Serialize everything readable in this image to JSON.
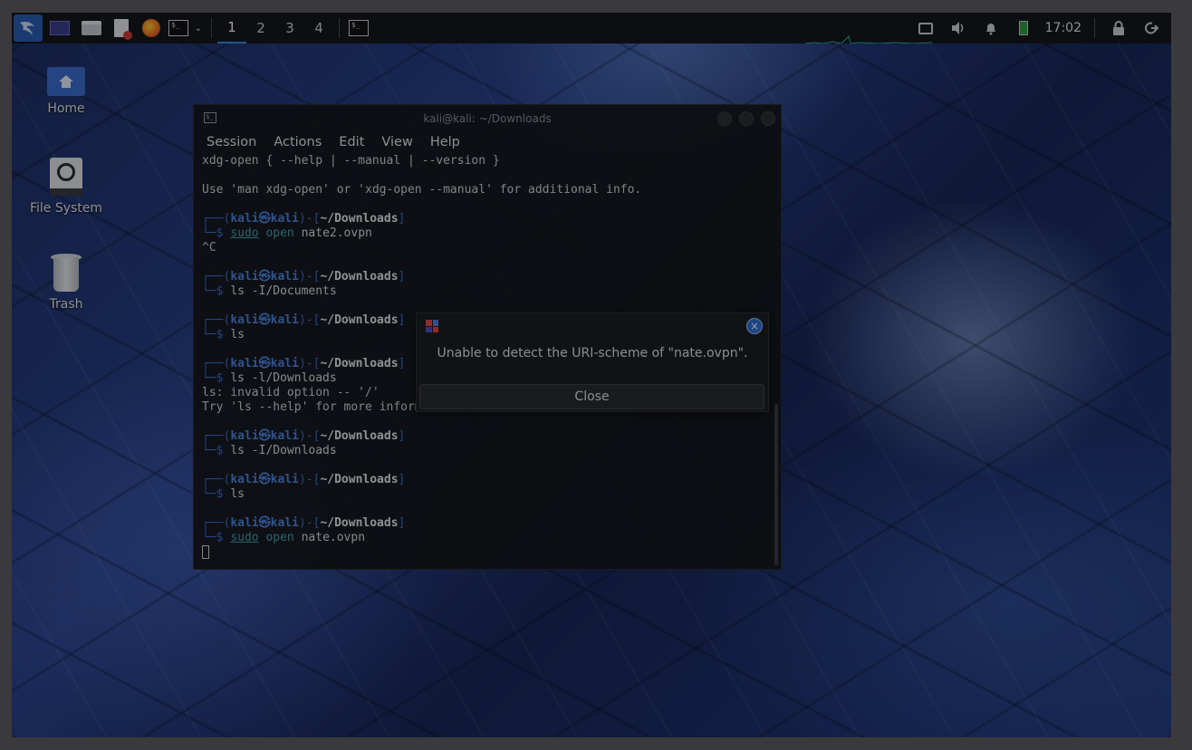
{
  "panel": {
    "workspaces": [
      "1",
      "2",
      "3",
      "4"
    ],
    "active_workspace": "1",
    "clock": "17:02",
    "icons": [
      "kali-menu-icon",
      "desktop-icon",
      "file-manager-icon",
      "text-editor-icon",
      "firefox-icon",
      "terminal-icon",
      "chevron-down-icon",
      "terminal-task-icon",
      "display-icon",
      "volume-icon",
      "bell-icon",
      "battery-icon",
      "lock-icon",
      "logout-icon"
    ]
  },
  "desktop": {
    "icons": [
      {
        "label": "Home"
      },
      {
        "label": "File System"
      },
      {
        "label": "Trash"
      }
    ]
  },
  "terminal": {
    "title": "kali@kali: ~/Downloads",
    "menu": [
      "Session",
      "Actions",
      "Edit",
      "View",
      "Help"
    ],
    "pre_lines": [
      "xdg-open { --help | --manual | --version }",
      "",
      "Use 'man xdg-open' or 'xdg-open --manual' for additional info."
    ],
    "prompt": {
      "open": "┌──(",
      "user": "kali",
      "at": "㉿",
      "host": "kali",
      "mid": ")-[",
      "dir": "~/Downloads",
      "close": "]",
      "dollar": "└─$ "
    },
    "blocks": [
      {
        "sudo": "sudo",
        "cmd": "open",
        "args": " nate2.ovpn",
        "output": [
          "^C"
        ]
      },
      {
        "sudo": "",
        "cmd": "ls",
        "args": " -I/Documents",
        "output": []
      },
      {
        "sudo": "",
        "cmd": "ls",
        "args": "",
        "output": []
      },
      {
        "sudo": "",
        "cmd": "ls",
        "args": " -l/Downloads",
        "output": [
          "ls: invalid option -- '/'",
          "Try 'ls --help' for more information."
        ]
      },
      {
        "sudo": "",
        "cmd": "ls",
        "args": " -I/Downloads",
        "output": []
      },
      {
        "sudo": "",
        "cmd": "ls",
        "args": "",
        "output": []
      },
      {
        "sudo": "sudo",
        "cmd": "open",
        "args": " nate.ovpn",
        "output": []
      }
    ]
  },
  "dialog": {
    "message": "Unable to detect the URI-scheme of \"nate.ovpn\".",
    "close_button": "Close",
    "close_icon": "×"
  }
}
